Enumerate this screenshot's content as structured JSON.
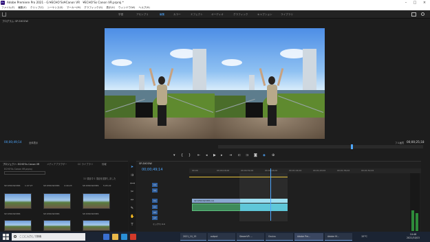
{
  "window": {
    "logo": "Pr",
    "title": "Adobe Premiere Pro 2021 - G:¥ECHO’Ss¥Canon VR　¥ECHO’Ss Canon VR.prproj *"
  },
  "menu": [
    "ファイル(F)",
    "編集(E)",
    "クリップ(C)",
    "シーケンス(S)",
    "マーカー(M)",
    "グラフィック(G)",
    "表示(V)",
    "ウィンドウ(W)",
    "ヘルプ(H)"
  ],
  "workspaces": [
    {
      "label": "学習",
      "active": false
    },
    {
      "label": "アセンブリ",
      "active": false
    },
    {
      "label": "編集",
      "active": true
    },
    {
      "label": "カラー",
      "active": false
    },
    {
      "label": "エフェクト",
      "active": false
    },
    {
      "label": "オーディオ",
      "active": false
    },
    {
      "label": "グラフィック",
      "active": false
    },
    {
      "label": "キャプション",
      "active": false
    },
    {
      "label": "ライブラリ",
      "active": false
    }
  ],
  "program_monitor": {
    "tab": "プログラム: SP-SHOOW",
    "timecode_left": "00;00;49;14",
    "fit": "全体表示",
    "fit_right": "フル画質",
    "timecode_right": "00;00;25;18"
  },
  "transport_icons": [
    "marker-icon",
    "in-point-icon",
    "out-point-icon",
    "go-to-in-icon",
    "step-back-icon",
    "play-icon",
    "step-forward-icon",
    "go-to-out-icon",
    "lift-icon",
    "extract-icon",
    "export-frame-icon",
    "vr-icon",
    "settings-icon"
  ],
  "project_panel": {
    "tabs": [
      {
        "label": "プロジェクト: ECHO'Ss Canon VR",
        "active": true
      },
      {
        "label": "メディアブラウザー",
        "active": false
      },
      {
        "label": "CC ライブラリ",
        "active": false
      },
      {
        "label": "情報",
        "active": false
      }
    ],
    "path": "ECHO'Ss Canon VR.prproj",
    "search_placeholder": "",
    "selected": "11 項目中 1 項目を選択しました",
    "items": [
      {
        "name": "SP-SHOOW.MP4",
        "duration": "1:47:27"
      },
      {
        "name": "SP-SHOOW.MP4",
        "duration": "4:49:23"
      },
      {
        "name": "SP-SHOOW.MP4",
        "duration": "5:05:22"
      },
      {
        "name": "SP-SHOOW.MP4",
        "duration": ""
      },
      {
        "name": "SP-SHOOW.MP4",
        "duration": ""
      },
      {
        "name": "SP-SHOOW.MP4",
        "duration": ""
      }
    ]
  },
  "timeline": {
    "tab": "SP-SHOOW",
    "timecode": "00;00;49;14",
    "ruler": [
      "00;00",
      "00;00;16;00",
      "00;00;32;00",
      "00;00;48;00",
      "00;01;04;02",
      "00;01;20;02",
      "00;01;36;02",
      "00;01;52;02"
    ],
    "video_tracks": [
      "V3",
      "V2",
      "V1"
    ],
    "audio_tracks": [
      "A1",
      "A2",
      "A3"
    ],
    "clip_label": "SP-SHOOW.MP4 [V]",
    "master": "ミックス",
    "master_value": "0.0"
  },
  "taskbar": {
    "search_placeholder": "ここに入力して検索",
    "apps": [
      {
        "label": "2021_10_15",
        "color": "#e8b84a"
      },
      {
        "label": "output",
        "color": "#e8b84a"
      },
      {
        "label": "SteamVR ...",
        "color": "#2a5fa8"
      },
      {
        "label": "Oculus",
        "color": "#e0622d"
      },
      {
        "label": "Adobe Pre...",
        "color": "#2a0a6b"
      },
      {
        "label": "Adobe M...",
        "color": "#2a0a6b"
      }
    ],
    "temperature": "15°C",
    "clock_time": "10:48",
    "clock_date": "2021/10/15"
  }
}
